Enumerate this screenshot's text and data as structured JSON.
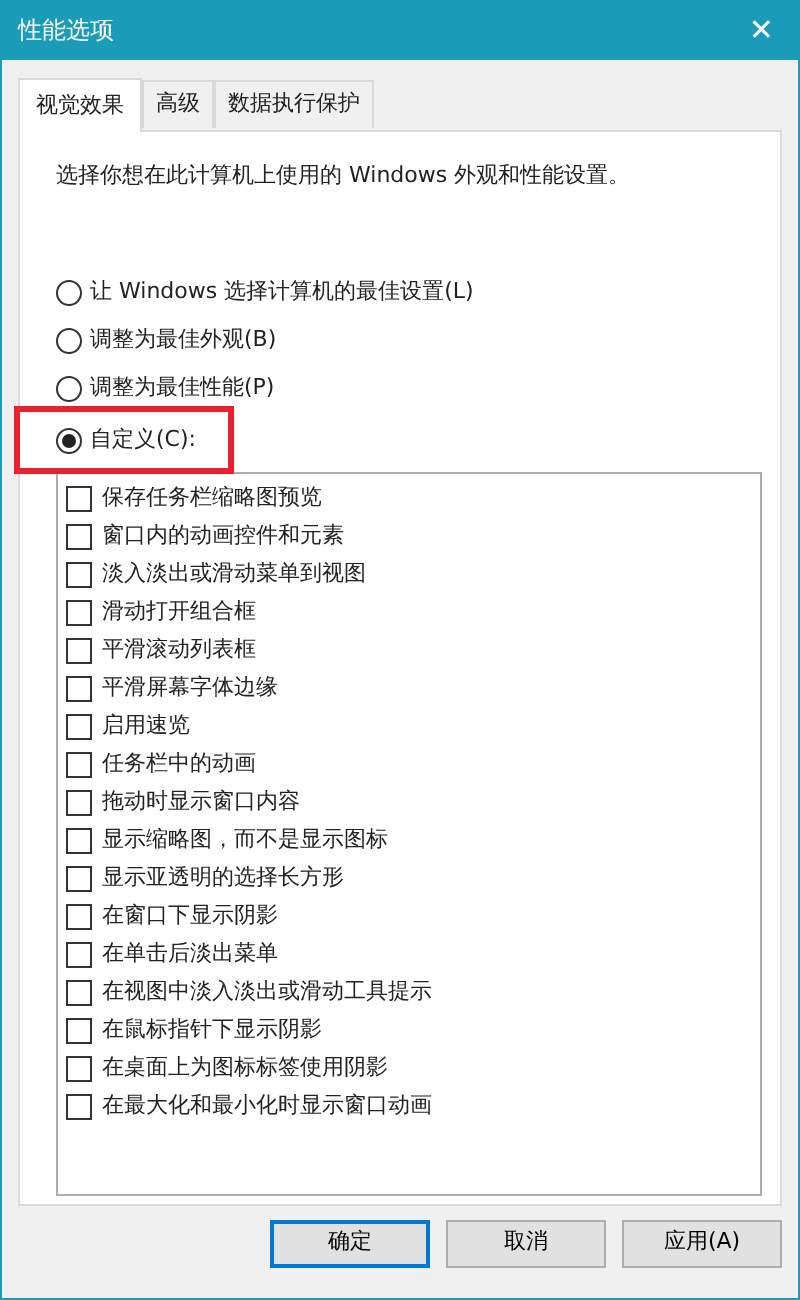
{
  "window": {
    "title": "性能选项",
    "close": "✕"
  },
  "tabs": [
    {
      "label": "视觉效果",
      "selected": true
    },
    {
      "label": "高级",
      "selected": false
    },
    {
      "label": "数据执行保护",
      "selected": false
    }
  ],
  "description": "选择你想在此计算机上使用的 Windows 外观和性能设置。",
  "options": [
    {
      "label": "让 Windows 选择计算机的最佳设置(L)",
      "selected": false,
      "highlighted": false
    },
    {
      "label": "调整为最佳外观(B)",
      "selected": false,
      "highlighted": false
    },
    {
      "label": "调整为最佳性能(P)",
      "selected": false,
      "highlighted": false
    },
    {
      "label": "自定义(C):",
      "selected": true,
      "highlighted": true
    }
  ],
  "effects": [
    {
      "label": "保存任务栏缩略图预览",
      "checked": false
    },
    {
      "label": "窗口内的动画控件和元素",
      "checked": false
    },
    {
      "label": "淡入淡出或滑动菜单到视图",
      "checked": false
    },
    {
      "label": "滑动打开组合框",
      "checked": false
    },
    {
      "label": "平滑滚动列表框",
      "checked": false
    },
    {
      "label": "平滑屏幕字体边缘",
      "checked": false
    },
    {
      "label": "启用速览",
      "checked": false
    },
    {
      "label": "任务栏中的动画",
      "checked": false
    },
    {
      "label": "拖动时显示窗口内容",
      "checked": false
    },
    {
      "label": "显示缩略图，而不是显示图标",
      "checked": false
    },
    {
      "label": "显示亚透明的选择长方形",
      "checked": false
    },
    {
      "label": "在窗口下显示阴影",
      "checked": false
    },
    {
      "label": "在单击后淡出菜单",
      "checked": false
    },
    {
      "label": "在视图中淡入淡出或滑动工具提示",
      "checked": false
    },
    {
      "label": "在鼠标指针下显示阴影",
      "checked": false
    },
    {
      "label": "在桌面上为图标标签使用阴影",
      "checked": false
    },
    {
      "label": "在最大化和最小化时显示窗口动画",
      "checked": false
    }
  ],
  "buttons": [
    {
      "label": "确定",
      "default": true
    },
    {
      "label": "取消",
      "default": false
    },
    {
      "label": "应用(A)",
      "default": false
    }
  ]
}
